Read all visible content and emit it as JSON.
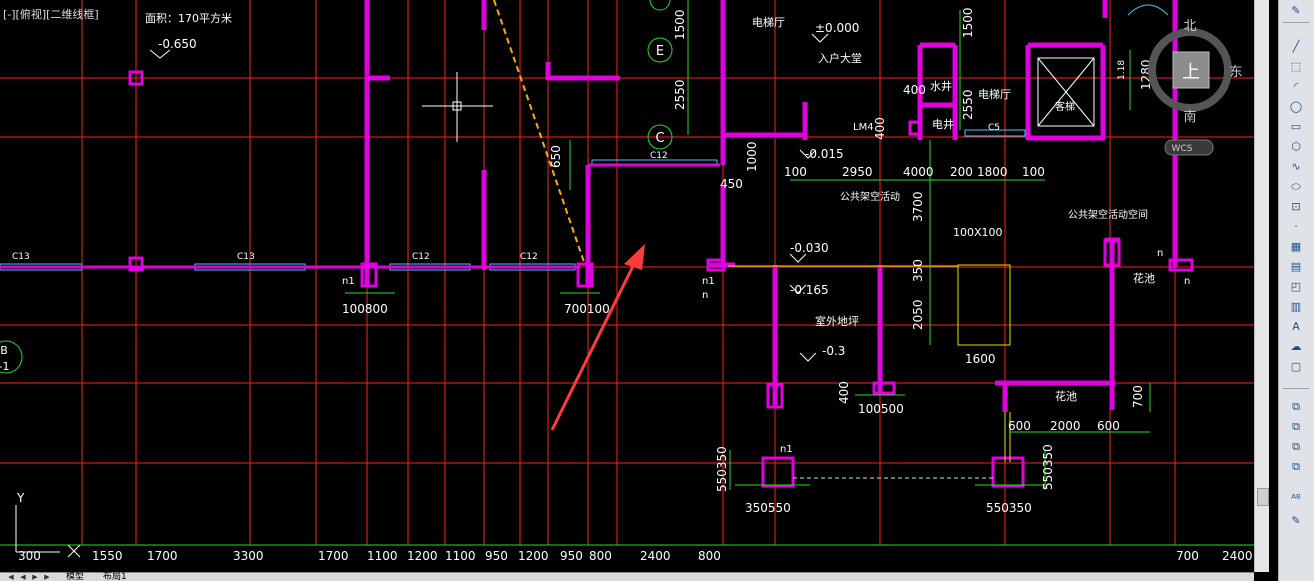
{
  "viewport_label": "[-][俯视][二维线框]",
  "top_notes": {
    "area": "面积：170平方米",
    "level_top": "-0.650"
  },
  "rooms": {
    "elevator_hall_1": "电梯厅",
    "elevator_hall_2": "电梯厅",
    "entry_hall": "入户大堂",
    "water_shaft": "水井",
    "elec_shaft": "电井",
    "public_activity": "公共架空活动",
    "public_space": "公共架空活动空间",
    "outdoor_floor": "室外地坪",
    "flower_bed_1": "花池",
    "flower_bed_2": "花池",
    "elevator": "客梯"
  },
  "level_marks": {
    "zero": "±0.000",
    "m015": "-0.015",
    "m030": "-0.030",
    "m165": "-0.165",
    "m03": "-0.3"
  },
  "small_labels": {
    "lm4": "LM4",
    "c5": "C5",
    "c12a": "C12",
    "c12b": "C12",
    "c12c": "C12",
    "c13a": "C13",
    "c13b": "C13",
    "c12d": "C12",
    "size_100x100": "100X100",
    "n1_a": "n1",
    "n1_b": "n1",
    "n1_c": "n1",
    "n_a": "n",
    "n_b": "n",
    "n_c": "n"
  },
  "axis_bubbles": {
    "e": "E",
    "c": "C",
    "b": "B",
    "b_sub": "-1"
  },
  "dimensions": {
    "d1500": "1500",
    "d2550a": "2550",
    "d2550b": "2550",
    "d1500b": "1500",
    "d400a": "400",
    "d400b": "400",
    "d1000": "1000",
    "d650": "650",
    "d450": "450",
    "d100a": "100",
    "d2950": "2950",
    "d400000": "4000",
    "d200": "200",
    "d1800": "1800",
    "d100b": "100",
    "d3700": "3700",
    "d350": "350",
    "d2050": "2050",
    "d1600": "1600",
    "d100800": "100800",
    "d700100": "700100",
    "d400c": "400",
    "d100500": "100500",
    "d600a": "600",
    "d2000": "2000",
    "d600b": "600",
    "d700": "700",
    "d550350a": "550350",
    "d350550": "350550",
    "d550350b": "550350",
    "d550350c": "550350",
    "d1280": "1280",
    "d118": "1.18"
  },
  "bottom_dims": [
    "300",
    "1550",
    "1700",
    "3300",
    "1700",
    "1100",
    "1200",
    "1100",
    "950",
    "1200",
    "950",
    "800",
    "2400",
    "800",
    "700",
    "2400"
  ],
  "viewcube": {
    "north": "北",
    "east": "东",
    "south": "南",
    "top": "上",
    "wcs": "WCS"
  },
  "ucs": {
    "y": "Y"
  },
  "tabs": {
    "model": "模型",
    "layout1": "布局1"
  },
  "colors": {
    "background": "#000000",
    "axis_red": "#ff2020",
    "wall_magenta": "#e000e0",
    "dim_green": "#22dd22",
    "text_white": "#ffffff",
    "orange_dash": "#ffaa00",
    "cyan_window": "#38d0ff",
    "yellow": "#e6e600",
    "arrow_red": "#ff3b3b"
  },
  "toolbar_icons": [
    "line-icon",
    "polyline-icon",
    "arc-icon",
    "circle-icon",
    "rectangle-icon",
    "polygon-icon",
    "spline-icon",
    "ellipse-icon",
    "insert-icon",
    "point-icon",
    "hatch-icon",
    "gradient-icon",
    "region-icon",
    "table-icon",
    "multiline-text-icon"
  ]
}
